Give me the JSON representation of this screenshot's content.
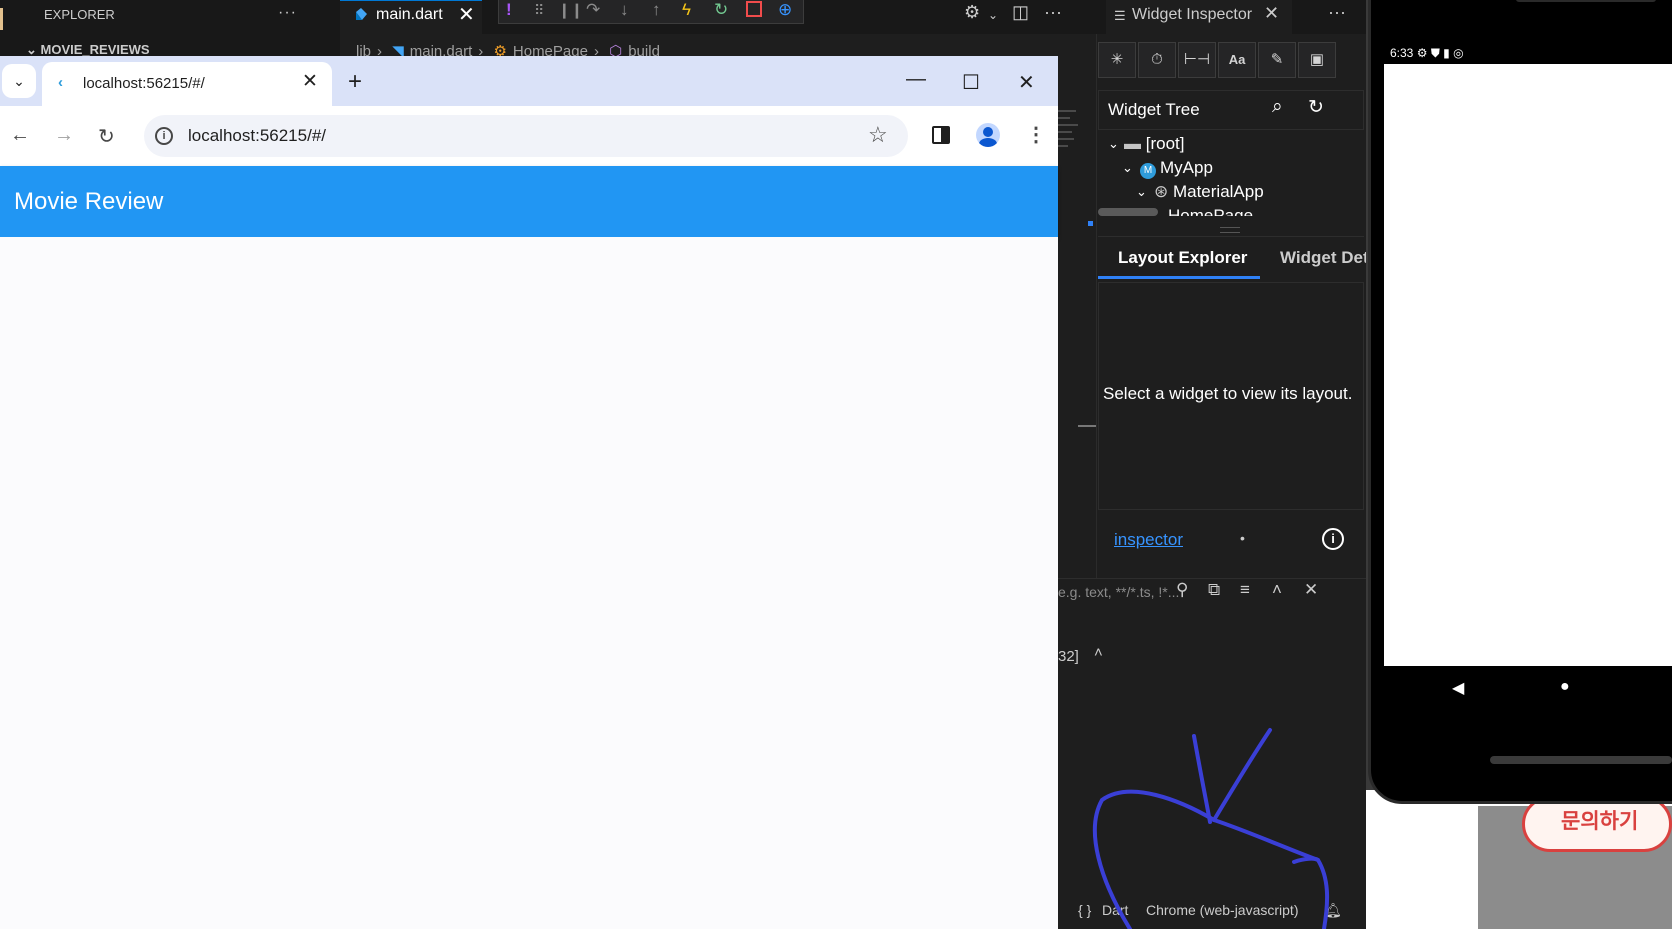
{
  "vscode": {
    "explorer_title": "EXPLORER",
    "explorer_more": "···",
    "section_title": "MOVIE_REVIEWS",
    "editor_tab": "main.dart",
    "tab_close": "✕",
    "breadcrumb": [
      "lib",
      "main.dart",
      "HomePage",
      "build"
    ],
    "more": "···"
  },
  "widget_inspector": {
    "tab_title": "Widget Inspector",
    "tab_close": "✕",
    "more": "···",
    "tree_title": "Widget Tree",
    "tree_nodes": [
      "[root]",
      "MyApp",
      "MaterialApp",
      "HomePage"
    ],
    "tab_layout_explorer": "Layout Explorer",
    "tab_widget_details": "Widget Details Tree",
    "empty_message": "Select a widget to view its layout.",
    "inspector_link": "inspector",
    "inspector_dot": "•"
  },
  "output_panel": {
    "filter_placeholder": "e.g. text, **/*.ts, !*...",
    "log_line": "32]",
    "status_braces": "{ }",
    "status_language": "Dart",
    "status_device": "Chrome (web-javascript)"
  },
  "chrome": {
    "tab_title": "localhost:56215/#/",
    "url": "localhost:56215/#/",
    "new_tab": "+",
    "minimize": "—",
    "maximize": "☐",
    "close": "✕"
  },
  "app": {
    "title": "Movie Review",
    "app_bar_color": "#2196f3"
  },
  "emulator": {
    "status_time": "6:33",
    "behind_button": "문의하기"
  }
}
